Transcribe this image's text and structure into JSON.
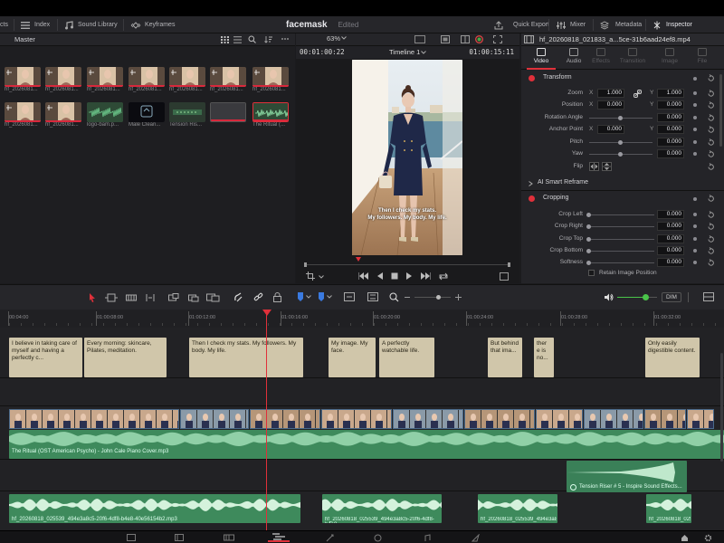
{
  "topbar": {},
  "menubar": {
    "cut_label": "cts",
    "index_label": "Index",
    "sound_library_label": "Sound Library",
    "keyframes_label": "Keyframes",
    "quick_export_label": "Quick Export",
    "mixer_label": "Mixer",
    "metadata_label": "Metadata",
    "inspector_label": "Inspector"
  },
  "project": {
    "title": "facemask",
    "status": "Edited"
  },
  "media_pool": {
    "bin_label": "Master",
    "zoom": "63%",
    "items": [
      {
        "label": "hf_2026081..."
      },
      {
        "label": "hf_2026081..."
      },
      {
        "label": "hf_2026081..."
      },
      {
        "label": "hf_2026081..."
      },
      {
        "label": "hf_2026081..."
      },
      {
        "label": "hf_2026081..."
      },
      {
        "label": "hf_2026081..."
      },
      {
        "label": "hf_2026081..."
      },
      {
        "label": "hf_2026081..."
      },
      {
        "label": "logo-bam.p..."
      },
      {
        "label": "Male Cleari..."
      },
      {
        "label": "Tension Ris..."
      },
      {
        "label": "The Ritual (..."
      }
    ]
  },
  "viewer": {
    "timecode_left": "00:01:00:22",
    "timeline_name": "Timeline 1",
    "timecode_right": "01:00:15:11",
    "caption_line1": "Then I check my stats.",
    "caption_line2": "My followers. My body. My life."
  },
  "inspector": {
    "filename": "hf_20260818_021833_a...5ce-31b6aad24ef8.mp4",
    "tabs": [
      "Video",
      "Audio",
      "Effects",
      "Transition",
      "Image",
      "File"
    ],
    "transform_label": "Transform",
    "zoom": {
      "label": "Zoom",
      "x": "1.000",
      "y": "1.000"
    },
    "position": {
      "label": "Position",
      "x": "0.000",
      "y": "0.000"
    },
    "rotation": {
      "label": "Rotation Angle",
      "value": "0.000"
    },
    "anchor": {
      "label": "Anchor Point",
      "x": "0.000",
      "y": "0.000"
    },
    "pitch": {
      "label": "Pitch",
      "value": "0.000"
    },
    "yaw": {
      "label": "Yaw",
      "value": "0.000"
    },
    "flip_label": "Flip",
    "smart_reframe_label": "AI Smart Reframe",
    "cropping_label": "Cropping",
    "crop_left": {
      "label": "Crop Left",
      "value": "0.000"
    },
    "crop_right": {
      "label": "Crop Right",
      "value": "0.000"
    },
    "crop_top": {
      "label": "Crop Top",
      "value": "0.000"
    },
    "crop_bottom": {
      "label": "Crop Bottom",
      "value": "0.000"
    },
    "softness": {
      "label": "Softness",
      "value": "0.000"
    },
    "retain_label": "Retain Image Position",
    "x_label": "X",
    "y_label": "Y"
  },
  "timeline": {
    "dim_label": "DIM",
    "volume_level": 0.7,
    "ruler": [
      "00:04:00",
      "01:00:08:00",
      "01:00:12:00",
      "01:00:16:00",
      "01:00:20:00",
      "01:00:24:00",
      "01:00:28:00",
      "01:00:32:00"
    ],
    "subtitles": [
      "I believe in taking care of myself and having a perfectly c...",
      "Every morning: skincare, Pilates, meditation.",
      "Then I check my stats. My followers. My body. My life.",
      "My image. My face.",
      "A perfectly watchable life.",
      "But behind that ima...",
      "ther e is no...",
      "Only easily digestible content."
    ],
    "music_label": "The Ritual (OST American Psycho) - John Cale  Piano Cover.mp3",
    "riser_label": "Tension Riser # 5 - Inspire Sound Effects...",
    "voice_label_1": "hf_20260818_025539_494e3a8c5-20f6-4df8-b4e8-40e56154b2.mp3",
    "voice_label_2": "hf_20260818_025539_494e3a8c5-20f6-4df8-b4e8",
    "voice_label_3": "hf_20260818_025539_494e3a8c5",
    "voice_label_4": "hf_20260818_025539"
  },
  "colors": {
    "accent": "#e0303a",
    "audio": "#3a8a5a",
    "subtitle": "#d0c6aa"
  }
}
